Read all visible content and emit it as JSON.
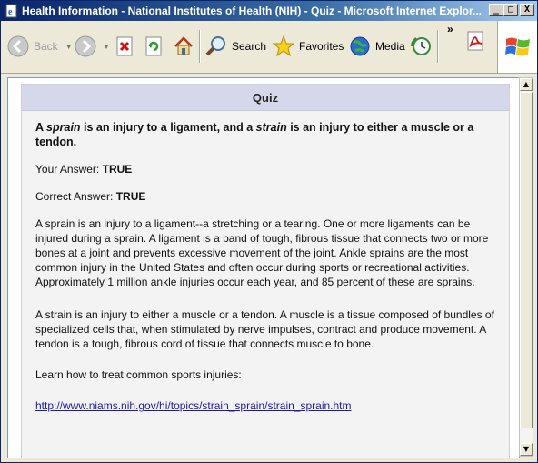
{
  "window": {
    "title": "Health Information - National Institutes of Health (NIH) - Quiz - Microsoft Internet Explor...",
    "minimize": "_",
    "maximize": "□",
    "close": "X"
  },
  "toolbar": {
    "back": "Back",
    "search": "Search",
    "favorites": "Favorites",
    "media": "Media",
    "chevron": "»"
  },
  "quiz": {
    "heading": "Quiz",
    "question_part1": "A ",
    "question_term1": "sprain",
    "question_part2": " is an injury to a ligament, and a ",
    "question_term2": "strain",
    "question_part3": " is an injury to either a muscle or a tendon.",
    "your_answer_label": "Your Answer: ",
    "your_answer": "TRUE",
    "correct_answer_label": "Correct Answer: ",
    "correct_answer": "TRUE",
    "explanation_sprain": "A sprain is an injury to a ligament--a stretching or a tearing. One or more ligaments can be injured during a sprain. A ligament is a band of tough, fibrous tissue that connects two or more bones at a joint and prevents excessive movement of the joint. Ankle sprains are the most common injury in the United States and often occur during sports or recreational activities. Approximately 1 million ankle injuries occur each year, and 85 percent of these are sprains.",
    "explanation_strain": "A strain is an injury to either a muscle or a tendon. A muscle is a tissue composed of bundles of specialized cells that, when stimulated by nerve impulses, contract and produce movement. A tendon is a tough, fibrous cord of tissue that connects muscle to bone.",
    "learn_more": "Learn how to treat common sports injuries:",
    "link": "http://www.niams.nih.gov/hi/topics/strain_sprain/strain_sprain.htm"
  },
  "colors": {
    "title_bar": "#0a246a",
    "quiz_header": "#d4d8ea",
    "link": "#1a1aa6"
  }
}
